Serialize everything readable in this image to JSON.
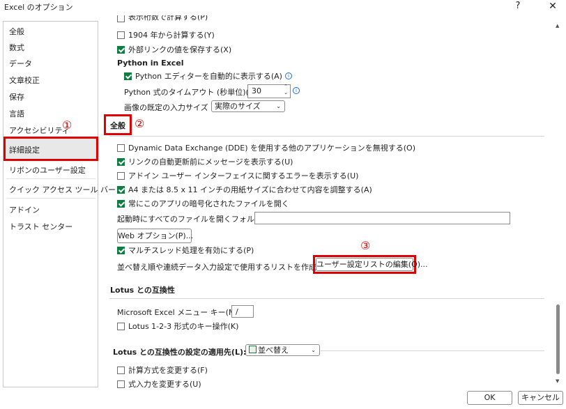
{
  "window": {
    "title": "Excel のオプション",
    "help": "?",
    "close": "✕"
  },
  "sidebar": {
    "items": [
      "全般",
      "数式",
      "データ",
      "文章校正",
      "保存",
      "言語",
      "アクセシビリティ",
      "詳細設定",
      "リボンのユーザー設定",
      "クイック アクセス ツール バー",
      "アドイン",
      "トラスト センター"
    ],
    "selected": "詳細設定"
  },
  "content": {
    "top_partial": "表示桁数で計算する(P)",
    "year1904": {
      "label": "1904 年から計算する(Y)",
      "checked": false
    },
    "save_external": {
      "label": "外部リンクの値を保存する(X)",
      "checked": true
    },
    "python_heading": "Python in Excel",
    "python_show_editor": {
      "label": "Python エディターを自動的に表示する(A)",
      "checked": true
    },
    "python_timeout_label": "Python 式のタイムアウト (秒単位)(P)",
    "python_timeout_value": "30",
    "image_size_label": "画像の既定の入力サイズ",
    "image_size_value": "実際のサイズ",
    "general_heading": "全般",
    "dde": {
      "label": "Dynamic Data Exchange (DDE) を使用する他のアプリケーションを無視する(O)",
      "checked": false
    },
    "ask_update": {
      "label": "リンクの自動更新前にメッセージを表示する(U)",
      "checked": true
    },
    "addin_errors": {
      "label": "アドイン ユーザー インターフェイスに関するエラーを表示する(U)",
      "checked": false
    },
    "a4_scale": {
      "label": "A4 または 8.5 x 11 インチの用紙サイズに合わせて内容を調整する(A)",
      "checked": true
    },
    "encrypted_open": {
      "label": "常にこのアプリの暗号化されたファイルを開く",
      "checked": true
    },
    "startup_folder_label": "起動時にすべてのファイルを開くフォルダー(L):",
    "startup_folder_value": "",
    "web_options_button": "Web オプション(P)...",
    "multithread": {
      "label": "マルチスレッド処理を有効にする(P)",
      "checked": true
    },
    "custom_list_label": "並べ替え順や連続データ入力設定で使用するリストを作成します:",
    "custom_list_button": "ユーザー設定リストの編集(O)...",
    "lotus_heading": "Lotus との互換性",
    "menu_key_label": "Microsoft Excel メニュー キー(M):",
    "menu_key_value": "/",
    "lotus_nav": {
      "label": "Lotus 1-2-3 形式のキー操作(K)",
      "checked": false
    },
    "lotus_settings_heading": "Lotus との互換性の設定の適用先(L):",
    "lotus_settings_value": "並べ替え",
    "formula_eval": {
      "label": "計算方式を変更する(F)",
      "checked": false
    },
    "formula_entry": {
      "label": "式入力を変更する(U)",
      "checked": false
    }
  },
  "annotations": {
    "one": "①",
    "two": "②",
    "three": "③"
  },
  "footer": {
    "ok": "OK",
    "cancel": "キャンセル"
  },
  "colors": {
    "accent_green": "#107c41",
    "highlight_red": "#e00000",
    "info_blue": "#1a6fd6"
  }
}
